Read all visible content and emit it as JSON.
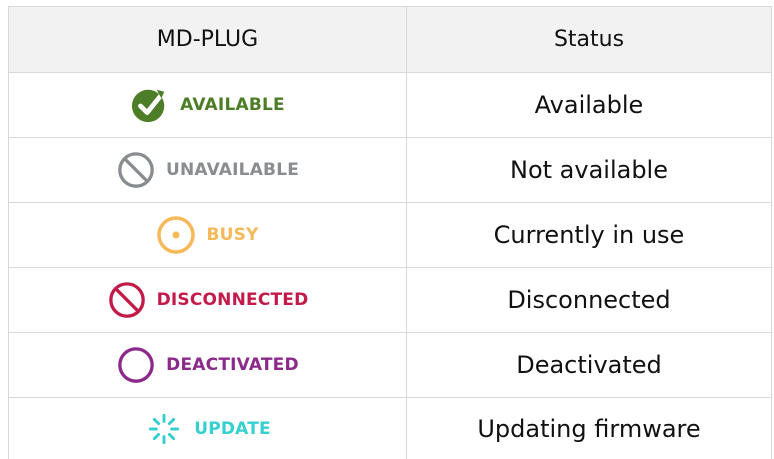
{
  "colors": {
    "available": "#4e7d28",
    "unavailable": "#8a8d90",
    "busy": "#f5b95a",
    "disconnected": "#c21b4a",
    "deactivated": "#8b2a8a",
    "update": "#35d0cf"
  },
  "table": {
    "headers": [
      "MD-PLUG",
      "Status"
    ],
    "rows": [
      {
        "badge": "AVAILABLE",
        "icon": "check-circle-icon",
        "status": "Available"
      },
      {
        "badge": "UNAVAILABLE",
        "icon": "prohibited-icon",
        "status": "Not available"
      },
      {
        "badge": "BUSY",
        "icon": "target-dot-icon",
        "status": "Currently in use"
      },
      {
        "badge": "DISCONNECTED",
        "icon": "prohibited-icon",
        "status": "Disconnected"
      },
      {
        "badge": "DEACTIVATED",
        "icon": "ring-icon",
        "status": "Deactivated"
      },
      {
        "badge": "UPDATE",
        "icon": "spinner-icon",
        "status": "Updating firmware"
      }
    ]
  }
}
